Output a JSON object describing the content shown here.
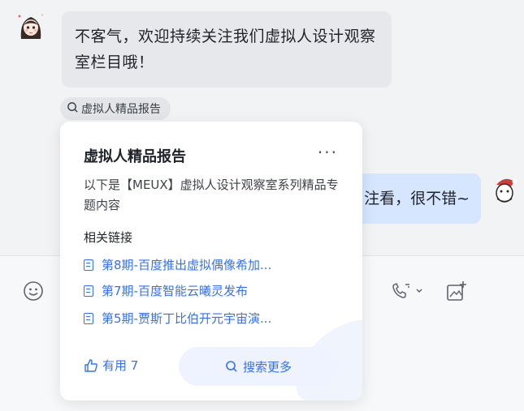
{
  "messages": {
    "left_text": "不客气，欢迎持续关注我们虚拟人设计观察室栏目哦！",
    "right_text_partial": "注看，很不错~"
  },
  "tag": {
    "icon": "search-icon",
    "label": "虚拟人精品报告"
  },
  "card": {
    "title": "虚拟人精品报告",
    "more_glyph": "···",
    "description": "以下是【MEUX】虚拟人设计观察室系列精品专题内容",
    "section_label": "相关链接",
    "links": [
      {
        "label": "第8期-百度推出虚拟偶像希加..."
      },
      {
        "label": "第7期-百度智能云曦灵发布"
      },
      {
        "label": "第5期-贾斯丁比伯开元宇宙演..."
      }
    ],
    "useful_label": "有用 7",
    "search_more_label": "搜索更多"
  },
  "toolbar": {
    "icons": [
      "emoji-icon",
      "phone-call-icon",
      "add-image-icon"
    ]
  },
  "colors": {
    "accent": "#3370ff",
    "left_bubble": "#e7e8eb",
    "right_bubble": "#d6e6ff"
  }
}
